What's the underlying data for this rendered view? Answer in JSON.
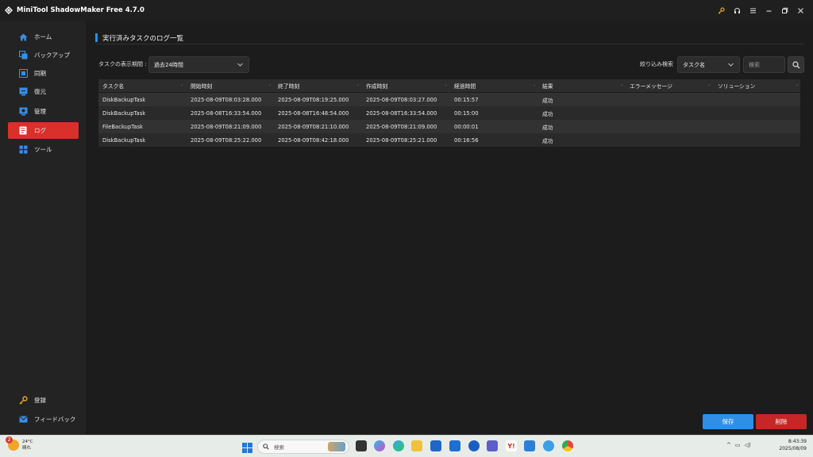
{
  "app": {
    "title": "MiniTool ShadowMaker Free 4.7.0"
  },
  "titlebar_icons": [
    "key-icon",
    "headset-icon",
    "menu-icon",
    "minimize-icon",
    "restore-icon",
    "close-icon"
  ],
  "sidebar": {
    "items": [
      {
        "label": "ホーム",
        "icon": "home-icon"
      },
      {
        "label": "バックアップ",
        "icon": "backup-icon"
      },
      {
        "label": "同期",
        "icon": "sync-icon"
      },
      {
        "label": "復元",
        "icon": "restore-icon"
      },
      {
        "label": "管理",
        "icon": "manage-icon"
      },
      {
        "label": "ログ",
        "icon": "log-icon",
        "active": true
      },
      {
        "label": "ツール",
        "icon": "tools-icon"
      }
    ],
    "bottom": [
      {
        "label": "登録",
        "icon": "key-icon"
      },
      {
        "label": "フィードバック",
        "icon": "mail-icon"
      }
    ]
  },
  "main": {
    "heading": "実行済みタスクのログ一覧",
    "period_label": "タスクの表示期間 :",
    "period_value": "過去24時間",
    "filter_label": "絞り込み検索",
    "filter_value": "タスク名",
    "search_placeholder": "検索"
  },
  "table": {
    "columns": [
      "タスク名",
      "開始時刻",
      "終了時刻",
      "作成時刻",
      "経過時間",
      "結果",
      "エラーメッセージ",
      "ソリューション"
    ],
    "rows": [
      [
        "DiskBackupTask",
        "2025-08-09T08:03:28.000",
        "2025-08-09T08:19:25.000",
        "2025-08-09T08:03:27.000",
        "00:15:57",
        "成功",
        "",
        ""
      ],
      [
        "DiskBackupTask",
        "2025-08-08T16:33:54.000",
        "2025-08-08T16:48:54.000",
        "2025-08-08T16:33:54.000",
        "00:15:00",
        "成功",
        "",
        ""
      ],
      [
        "FileBackupTask",
        "2025-08-09T08:21:09.000",
        "2025-08-09T08:21:10.000",
        "2025-08-09T08:21:09.000",
        "00:00:01",
        "成功",
        "",
        ""
      ],
      [
        "DiskBackupTask",
        "2025-08-09T08:25:22.000",
        "2025-08-09T08:42:18.000",
        "2025-08-09T08:25:21.000",
        "00:16:56",
        "成功",
        "",
        ""
      ]
    ]
  },
  "buttons": {
    "save": "保存",
    "delete": "削除"
  },
  "taskbar": {
    "weather_temp": "24°C",
    "weather_desc": "晴れ",
    "weather_badge": "2",
    "search_label": "検索",
    "time": "8:43:39",
    "date": "2025/08/09"
  },
  "colors": {
    "accent": "#2f8fe6",
    "active_nav": "#d9302c",
    "delete": "#c62626"
  }
}
